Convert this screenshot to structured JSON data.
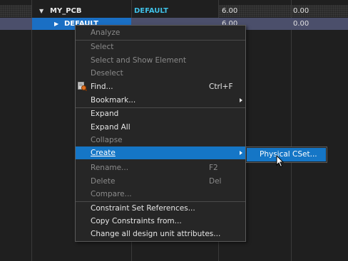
{
  "table": {
    "rows": [
      {
        "name": "MY_PCB",
        "cset": "DEFAULT",
        "val1": "6.00",
        "val2": "0.00"
      },
      {
        "name": "DEFAULT",
        "cset": "",
        "val1": "6.00",
        "val2": "0.00"
      }
    ]
  },
  "context_menu": {
    "items": [
      {
        "label": "Analyze"
      },
      {
        "label": "Select"
      },
      {
        "label": "Select and Show Element"
      },
      {
        "label": "Deselect"
      },
      {
        "label": "Find...",
        "shortcut": "Ctrl+F"
      },
      {
        "label": "Bookmark..."
      },
      {
        "label": "Expand"
      },
      {
        "label": "Expand All"
      },
      {
        "label": "Collapse"
      },
      {
        "label": "Create"
      },
      {
        "label": "Rename...",
        "shortcut": "F2"
      },
      {
        "label": "Delete",
        "shortcut": "Del"
      },
      {
        "label": "Compare..."
      },
      {
        "label": "Constraint Set References..."
      },
      {
        "label": "Copy Constraints from..."
      },
      {
        "label": "Change all design unit attributes..."
      }
    ]
  },
  "submenu": {
    "items": [
      {
        "label": "Physical CSet..."
      }
    ]
  },
  "colors": {
    "accent": "#1576c6",
    "cset_text": "#3fc0e6",
    "selected_row": "#4b4f6b",
    "selected_cell": "#1a6fc4"
  }
}
